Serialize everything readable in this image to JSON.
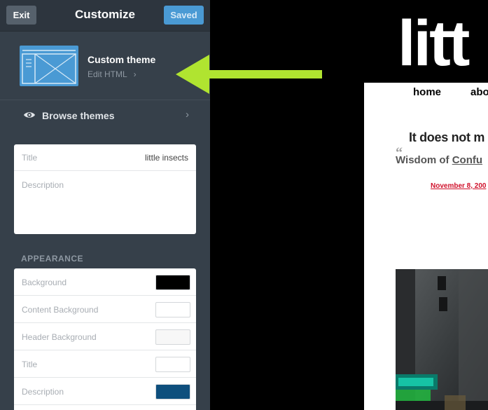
{
  "topbar": {
    "exit_label": "Exit",
    "title": "Customize",
    "saved_label": "Saved"
  },
  "theme": {
    "name": "Custom theme",
    "edit_label": "Edit HTML"
  },
  "browse": {
    "label": "Browse themes"
  },
  "info": {
    "title_label": "Title",
    "title_value": "little insects",
    "description_label": "Description",
    "description_value": ""
  },
  "appearance": {
    "section_title": "APPEARANCE",
    "rows": [
      {
        "label": "Background",
        "color": "#000000"
      },
      {
        "label": "Content Background",
        "color": "#ffffff"
      },
      {
        "label": "Header Background",
        "color": "#f7f7f7"
      },
      {
        "label": "Title",
        "color": "#ffffff"
      },
      {
        "label": "Description",
        "color": "#0e4f7d"
      }
    ]
  },
  "preview": {
    "blog_title": "litt",
    "nav": {
      "home": "home",
      "about": "abo"
    },
    "quote_text": "It does not m",
    "quote_mark": "“",
    "quote_source_prefix": "Wisdom of ",
    "quote_source_link": "Confu",
    "post_date": "November 8, 200"
  },
  "colors": {
    "sidebar": "#36404a",
    "accent": "#4a9ad4",
    "arrow": "#b0e430",
    "date": "#d0112b"
  }
}
